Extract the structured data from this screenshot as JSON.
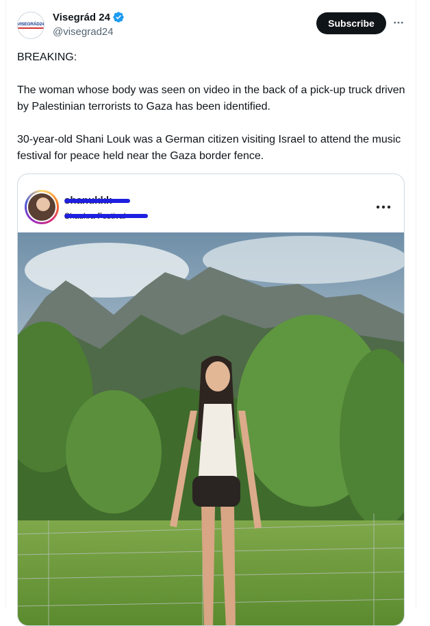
{
  "account": {
    "display_name": "Visegrád 24",
    "handle": "@visegrad24",
    "avatar_logo": "VISEGRÁD24",
    "verified_icon": "verified-badge-icon"
  },
  "actions": {
    "subscribe_label": "Subscribe",
    "more_icon": "more-horizontal-icon"
  },
  "tweet": {
    "paragraphs": [
      "BREAKING:",
      "The woman whose body was seen on video in the back of a pick-up truck driven by Palestinian terrorists to Gaza has been identified.",
      "30-year-old Shani Louk was a German citizen visiting Israel to attend the music festival for peace held near the Gaza border fence."
    ]
  },
  "embed": {
    "username": "shanukkk",
    "location": "Shaukra Festival",
    "more_icon": "more-horizontal-icon",
    "scribble_color": "#1f1fe0"
  },
  "colors": {
    "subscribe_bg": "#0f1419",
    "verified": "#1d9bf0"
  }
}
